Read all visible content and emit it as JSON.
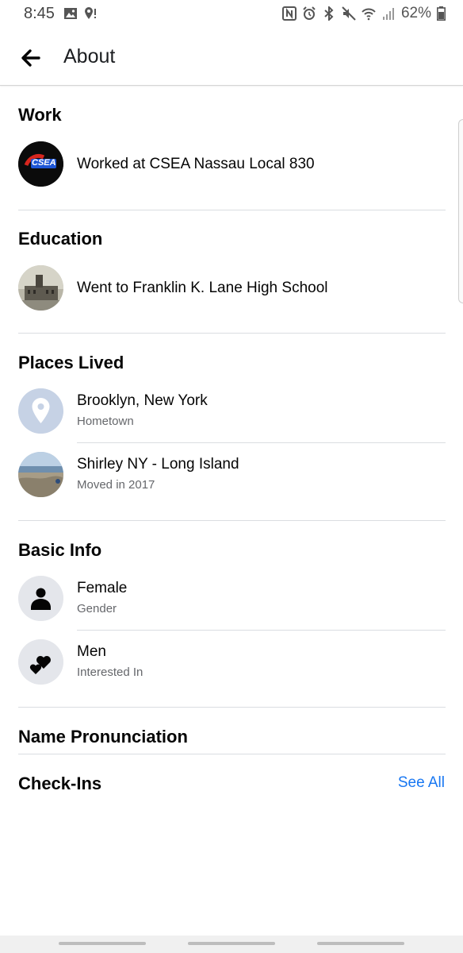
{
  "status_bar": {
    "time": "8:45",
    "battery": "62%"
  },
  "header": {
    "title": "About"
  },
  "sections": {
    "work": {
      "title": "Work",
      "item": "Worked at CSEA Nassau Local 830",
      "logo_text": "CSEA"
    },
    "education": {
      "title": "Education",
      "item": "Went to Franklin K. Lane High School"
    },
    "places": {
      "title": "Places Lived",
      "items": [
        {
          "primary": "Brooklyn, New York",
          "secondary": "Hometown"
        },
        {
          "primary": "Shirley NY - Long Island",
          "secondary": "Moved in 2017"
        }
      ]
    },
    "basic_info": {
      "title": "Basic Info",
      "items": [
        {
          "primary": "Female",
          "secondary": "Gender"
        },
        {
          "primary": "Men",
          "secondary": "Interested In"
        }
      ]
    },
    "name_pronunciation": {
      "title": "Name Pronunciation"
    },
    "checkins": {
      "title": "Check-Ins",
      "see_all": "See All"
    }
  },
  "colors": {
    "link": "#1877f2",
    "secondary_text": "#65676b",
    "divider": "#dadde1",
    "icon_bg": "#e4e6eb"
  }
}
